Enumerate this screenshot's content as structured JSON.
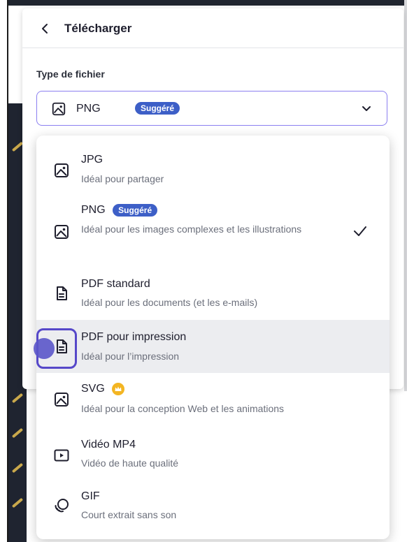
{
  "header": {
    "title": "Télécharger"
  },
  "file_type": {
    "label": "Type de fichier",
    "selected_value": "PNG",
    "selected_badge": "Suggéré"
  },
  "options": [
    {
      "title": "JPG",
      "description": "Idéal pour partager",
      "icon": "image-icon"
    },
    {
      "title": "PNG",
      "badge": "Suggéré",
      "description": "Idéal pour les images complexes et les illustrations",
      "icon": "image-icon",
      "selected": true
    },
    {
      "title": "PDF standard",
      "description": "Idéal pour les documents (et les e-mails)",
      "icon": "document-icon"
    },
    {
      "title": "PDF pour impression",
      "description": "Idéal pour l’impression",
      "icon": "document-icon",
      "highlighted": true
    },
    {
      "title": "SVG",
      "description": "Idéal pour la conception Web et les animations",
      "icon": "image-icon",
      "premium": true
    },
    {
      "title": "Vidéo MP4",
      "description": "Vidéo de haute qualité",
      "icon": "video-icon"
    },
    {
      "title": "GIF",
      "description": "Court extrait sans son",
      "icon": "gif-icon"
    }
  ],
  "colors": {
    "accent": "#8b7ff0",
    "badge": "#3d5fc7",
    "highlight": "#ecedf0",
    "premium": "#f3b522",
    "focus": "#5648c9"
  }
}
